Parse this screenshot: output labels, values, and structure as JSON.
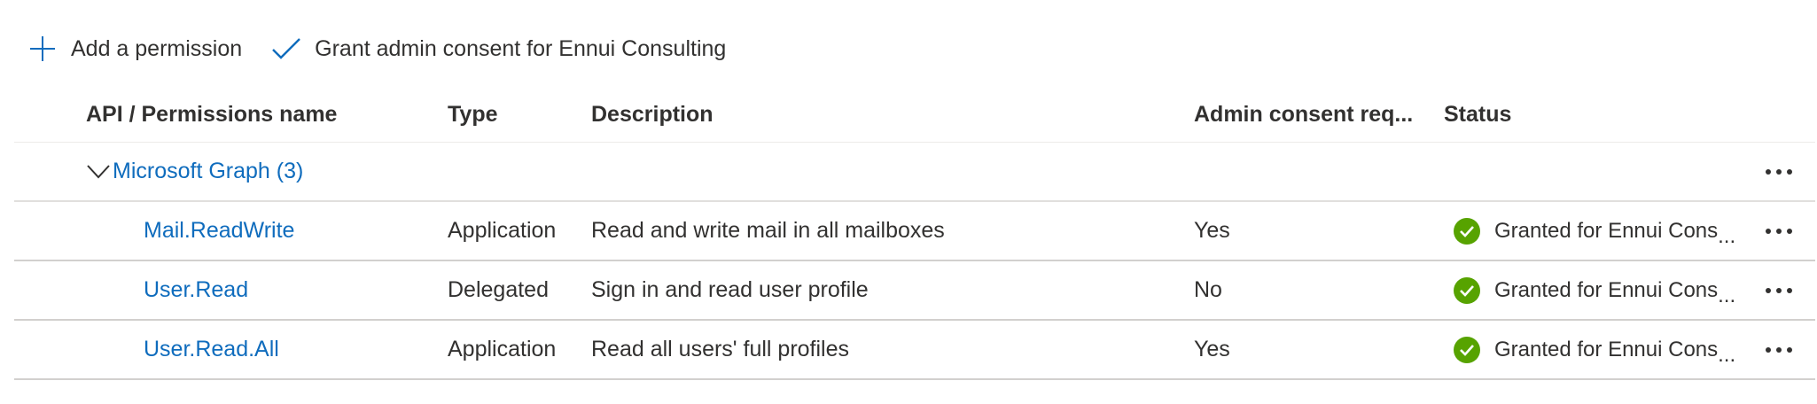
{
  "toolbar": {
    "add_permission_label": "Add a permission",
    "grant_consent_label": "Grant admin consent for Ennui Consulting",
    "accent_color": "#0f6cbd"
  },
  "table": {
    "columns": [
      "API / Permissions name",
      "Type",
      "Description",
      "Admin consent req...",
      "Status"
    ],
    "group": {
      "label": "Microsoft Graph (3)",
      "expanded": true
    },
    "rows": [
      {
        "name": "Mail.ReadWrite",
        "type": "Application",
        "description": "Read and write mail in all mailboxes",
        "admin_consent": "Yes",
        "status": "Granted for Ennui Cons",
        "status_overflow": "..."
      },
      {
        "name": "User.Read",
        "type": "Delegated",
        "description": "Sign in and read user profile",
        "admin_consent": "No",
        "status": "Granted for Ennui Cons",
        "status_overflow": "..."
      },
      {
        "name": "User.Read.All",
        "type": "Application",
        "description": "Read all users' full profiles",
        "admin_consent": "Yes",
        "status": "Granted for Ennui Cons",
        "status_overflow": "..."
      }
    ],
    "status_icon": "check-circle-icon",
    "status_color": "#57a300",
    "more_icon": "more-options-icon"
  }
}
